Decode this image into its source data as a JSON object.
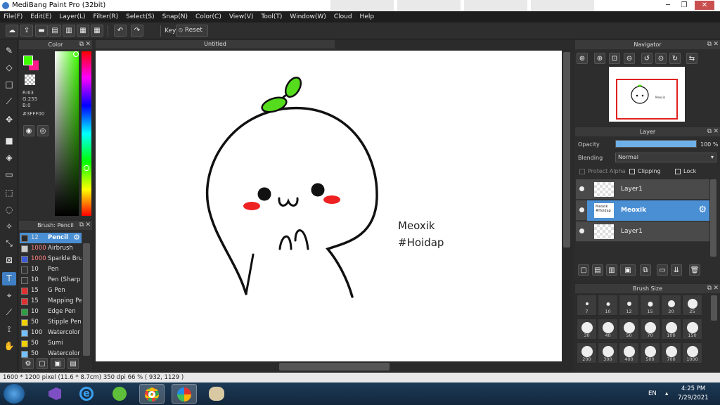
{
  "window": {
    "title": "MediBang Paint Pro (32bit)",
    "minimize": "─",
    "restore": "❐",
    "close": "✕"
  },
  "menu": [
    "File(F)",
    "Edit(E)",
    "Layer(L)",
    "Filter(R)",
    "Select(S)",
    "Snap(N)",
    "Color(C)",
    "View(V)",
    "Tool(T)",
    "Window(W)",
    "Cloud",
    "Help"
  ],
  "toolbar": {
    "key_label": "Key",
    "reset_label": "Reset"
  },
  "color_panel": {
    "title": "Color",
    "r": "R:63",
    "g": "G:255",
    "b": "B:0",
    "hex": "#3FFF00",
    "fg_color": "#3fff00",
    "bg_color": "#ff1a8c"
  },
  "brush_panel": {
    "title": "Brush: Pencil",
    "items": [
      {
        "size": "12",
        "name": "Pencil",
        "color": "#2a2a2a"
      },
      {
        "size": "1000",
        "name": "Airbrush",
        "color": "#cccccc"
      },
      {
        "size": "1000",
        "name": "Sparkle Brus",
        "color": "#3b5bdb"
      },
      {
        "size": "10",
        "name": "Pen",
        "color": "#333333"
      },
      {
        "size": "10",
        "name": "Pen (Sharp",
        "color": "#333333"
      },
      {
        "size": "15",
        "name": "G Pen",
        "color": "#e03131"
      },
      {
        "size": "15",
        "name": "Mapping Pe",
        "color": "#e03131"
      },
      {
        "size": "10",
        "name": "Edge Pen",
        "color": "#2f9e44"
      },
      {
        "size": "50",
        "name": "Stipple Pen",
        "color": "#f0d000"
      },
      {
        "size": "100",
        "name": "Watercolor",
        "color": "#74c0fc"
      },
      {
        "size": "50",
        "name": "Sumi",
        "color": "#f0d000"
      },
      {
        "size": "50",
        "name": "Watercolor",
        "color": "#74c0fc"
      }
    ]
  },
  "canvas": {
    "tab_title": "Untitled",
    "note_line1": "Meoxik",
    "note_line2": "#Hoidap"
  },
  "navigator": {
    "title": "Navigator"
  },
  "layer_panel": {
    "title": "Layer",
    "opacity_label": "Opacity",
    "opacity_value": "100 %",
    "opacity_fraction": 1.0,
    "blending_label": "Blending",
    "blending_value": "Normal",
    "protect_alpha": "Protect Alpha",
    "clipping": "Clipping",
    "lock": "Lock",
    "layers": [
      {
        "name": "Layer1",
        "active": false
      },
      {
        "name": "Meoxik",
        "thumb_text": "Meoxik\n#Hoidap",
        "active": true
      },
      {
        "name": "Layer1",
        "active": false
      }
    ]
  },
  "brush_size_panel": {
    "title": "Brush Size",
    "sizes": [
      "7",
      "10",
      "12",
      "15",
      "20",
      "25",
      "30",
      "40",
      "50",
      "70",
      "100",
      "150",
      "200",
      "300",
      "400",
      "500",
      "700",
      "1000"
    ]
  },
  "status_bar": {
    "text": "1600 * 1200 pixel   (11.6 * 8.7cm)   350 dpi   66 %   ( 932, 1129 )"
  },
  "taskbar": {
    "lang": "EN",
    "time": "4:25 PM",
    "date": "7/29/2021"
  }
}
